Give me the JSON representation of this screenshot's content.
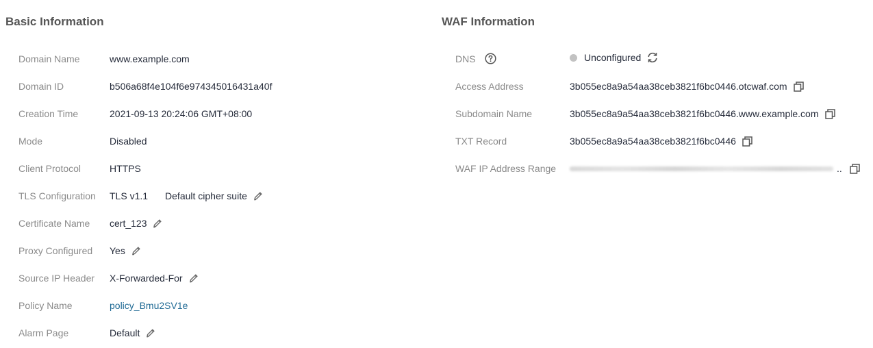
{
  "basic": {
    "title": "Basic Information",
    "rows": [
      {
        "label": "Domain Name",
        "value": "www.example.com"
      },
      {
        "label": "Domain ID",
        "value": "b506a68f4e104f6e974345016431a40f"
      },
      {
        "label": "Creation Time",
        "value": "2021-09-13 20:24:06 GMT+08:00"
      },
      {
        "label": "Mode",
        "value": "Disabled"
      },
      {
        "label": "Client Protocol",
        "value": "HTTPS"
      },
      {
        "label": "TLS Configuration",
        "value": "TLS v1.1",
        "extra": "Default cipher suite"
      },
      {
        "label": "Certificate Name",
        "value": "cert_123"
      },
      {
        "label": "Proxy Configured",
        "value": "Yes"
      },
      {
        "label": "Source IP Header",
        "value": "X-Forwarded-For"
      },
      {
        "label": "Policy Name",
        "value": "policy_Bmu2SV1e"
      },
      {
        "label": "Alarm Page",
        "value": "Default"
      }
    ]
  },
  "waf": {
    "title": "WAF Information",
    "rows": [
      {
        "label": "DNS",
        "value": "Unconfigured"
      },
      {
        "label": "Access Address",
        "value": "3b055ec8a9a54aa38ceb3821f6bc0446.otcwaf.com"
      },
      {
        "label": "Subdomain Name",
        "value": "3b055ec8a9a54aa38ceb3821f6bc0446.www.example.com"
      },
      {
        "label": "TXT Record",
        "value": "3b055ec8a9a54aa38ceb3821f6bc0446"
      },
      {
        "label": "WAF IP Address Range",
        "value": ".."
      }
    ]
  },
  "colors": {
    "link": "#216b95",
    "status_unconfigured": "#c2c2c2",
    "label": "#8a8a8a",
    "text": "#252b3a"
  },
  "icons": [
    "edit-icon",
    "copy-icon",
    "refresh-icon",
    "help-icon"
  ]
}
